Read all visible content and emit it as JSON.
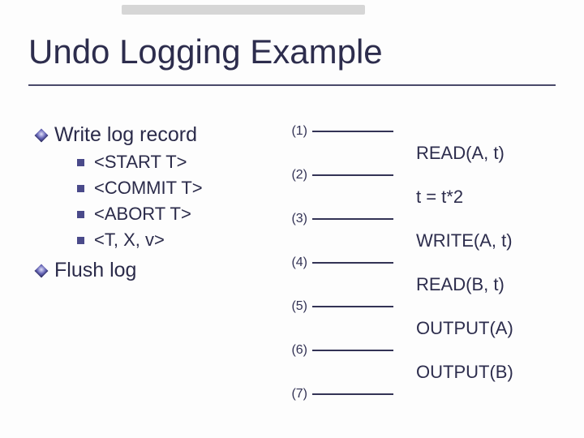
{
  "title": "Undo Logging Example",
  "left": {
    "top_bullets": [
      "Write log record"
    ],
    "sub_bullets": [
      "<START T>",
      "<COMMIT T>",
      "<ABORT T>",
      "<T, X, v>"
    ],
    "bottom_bullets": [
      "Flush log"
    ]
  },
  "steps": {
    "numbers": [
      "(1)",
      "(2)",
      "(3)",
      "(4)",
      "(5)",
      "(6)",
      "(7)"
    ],
    "between_labels": [
      "READ(A, t)",
      "t = t*2",
      "WRITE(A, t)",
      "READ(B, t)",
      "OUTPUT(A)",
      "OUTPUT(B)"
    ]
  }
}
